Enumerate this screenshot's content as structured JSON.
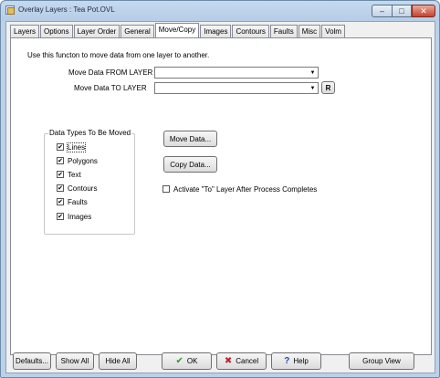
{
  "window": {
    "title": "Overlay Layers : Tea Pot.OVL",
    "minimize_glyph": "–",
    "maximize_glyph": "□",
    "close_glyph": "✕"
  },
  "tabs": [
    {
      "label": "Layers"
    },
    {
      "label": "Options"
    },
    {
      "label": "Layer Order"
    },
    {
      "label": "General"
    },
    {
      "label": "Move/Copy",
      "active": true
    },
    {
      "label": "Images"
    },
    {
      "label": "Contours"
    },
    {
      "label": "Faults"
    },
    {
      "label": "Misc"
    },
    {
      "label": "Volm"
    }
  ],
  "move_copy": {
    "intro": "Use this functon to move data from one layer to another.",
    "from_label": "Move Data FROM LAYER",
    "from_value": "",
    "to_label": "Move Data TO LAYER",
    "to_value": "",
    "r_button": "R",
    "group_title": "Data Types To Be Moved",
    "data_types": [
      {
        "label": "Lines",
        "checked": true
      },
      {
        "label": "Polygons",
        "checked": true
      },
      {
        "label": "Text",
        "checked": true
      },
      {
        "label": "Contours",
        "checked": true
      },
      {
        "label": "Faults",
        "checked": true
      },
      {
        "label": "Images",
        "checked": true
      }
    ],
    "move_button": "Move Data...",
    "copy_button": "Copy Data...",
    "activate_label": "Activate \"To\" Layer After Process Completes",
    "activate_checked": false
  },
  "footer": {
    "defaults": "Defaults...",
    "show_all": "Show All",
    "hide_all": "Hide All",
    "ok": "OK",
    "cancel": "Cancel",
    "help": "Help",
    "group_view": "Group View"
  },
  "icons": {
    "ok": "✔",
    "cancel": "✖",
    "help": "?",
    "dropdown": "▼",
    "check": "✔"
  },
  "colors": {
    "ok_icon": "#2a9b2a",
    "cancel_icon": "#c0262a",
    "help_icon": "#1e50b4"
  }
}
